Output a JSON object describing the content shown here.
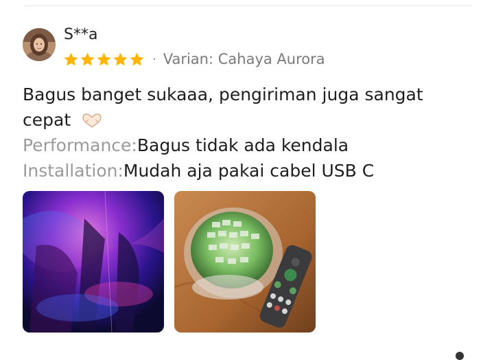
{
  "review": {
    "username": "S**a",
    "rating": 5,
    "variant_label": "Varian: Cahaya Aurora",
    "text_line1": "Bagus banget sukaaa, pengiriman juga sangat",
    "text_line2": "cepat",
    "performance_label": "Performance:",
    "performance_value": "Bagus tidak ada kendala",
    "installation_label": "Installation:",
    "installation_value": "Mudah aja pakai cabel USB C"
  },
  "icons": {
    "star": "star-icon",
    "heart": "heart-hands-icon"
  },
  "colors": {
    "star": "#FFB400",
    "muted": "#9a9a9a"
  }
}
